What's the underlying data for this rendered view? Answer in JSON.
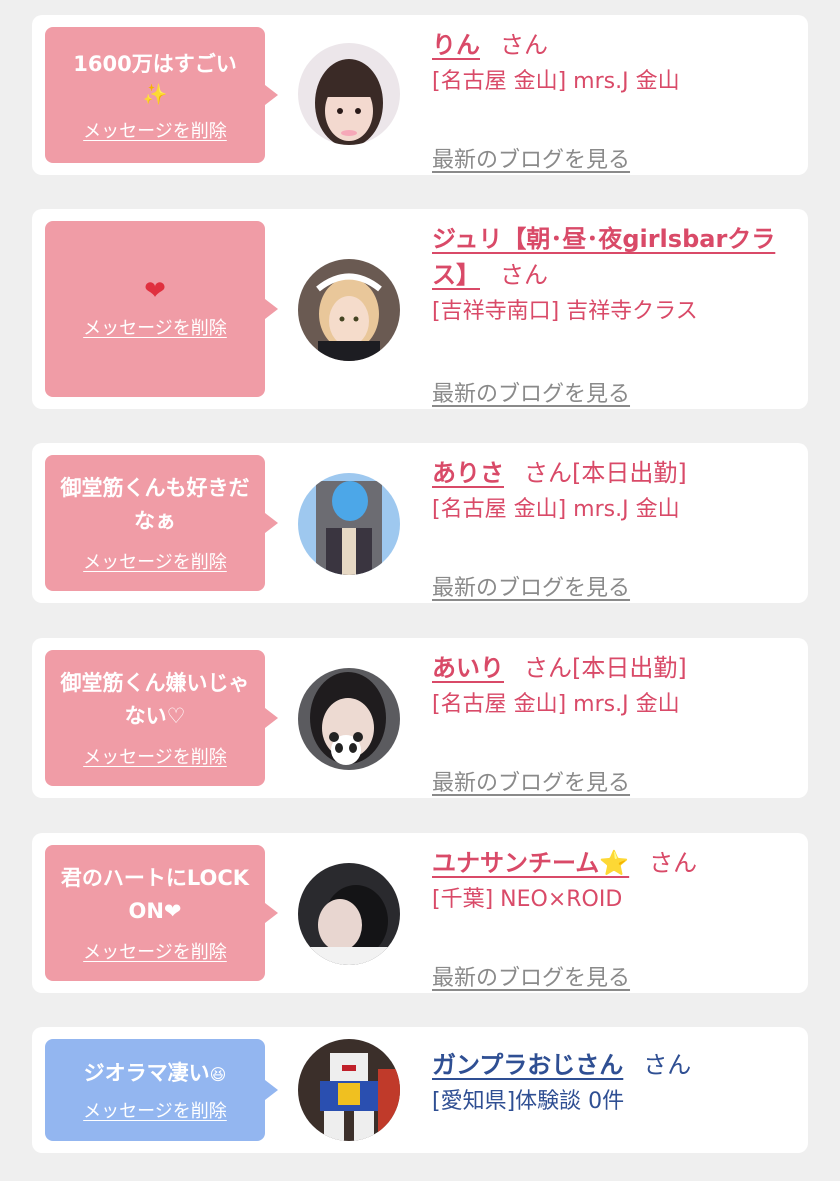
{
  "common": {
    "delete_label": "メッセージを削除",
    "blog_label": "最新のブログを見る",
    "san": "さん"
  },
  "colors": {
    "pink": "#f09ca6",
    "blue": "#93b6f0",
    "name_pink": "#d94a68",
    "name_blue": "#2f4f93"
  },
  "cards": [
    {
      "message": "1600万はすごい",
      "emoji": "✨",
      "name": "りん",
      "suffix": "さん",
      "shop": "[名古屋 金山] mrs.J 金山"
    },
    {
      "message": "",
      "emoji": "❤",
      "name": "ジュリ【朝･昼･夜girlsbarクラス】",
      "suffix": "さん",
      "shop": "[吉祥寺南口] 吉祥寺クラス"
    },
    {
      "message": "御堂筋くんも好きだなぁ",
      "name": "ありさ",
      "suffix": "さん[本日出勤]",
      "shop": "[名古屋 金山] mrs.J 金山"
    },
    {
      "message": "御堂筋くん嫌いじゃない♡",
      "name": "あいり",
      "suffix": "さん[本日出勤]",
      "shop": "[名古屋 金山] mrs.J 金山"
    },
    {
      "message": "君のハートにLOCKON❤",
      "name": "ユナサンチーム⭐",
      "suffix": "さん",
      "shop": "[千葉] NEO×ROID"
    },
    {
      "message": "ジオラマ凄い",
      "emoji": "😆",
      "name": "ガンプラおじさん",
      "suffix": "さん",
      "shop": "[愛知県]体験談 0件"
    }
  ]
}
